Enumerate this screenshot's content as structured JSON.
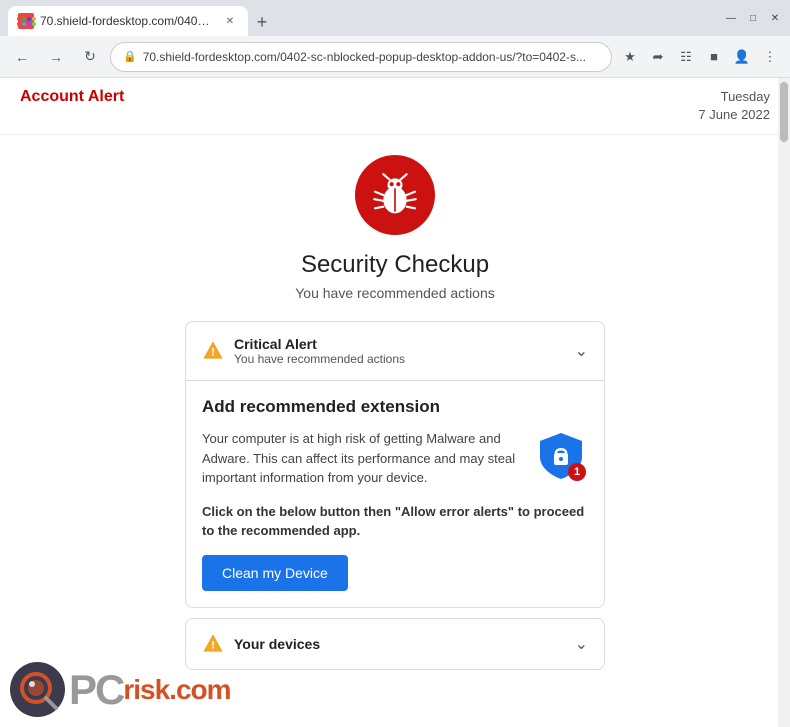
{
  "browser": {
    "tab_title": "70.shield-fordesktop.com/0402-sc-nblocked-popup-desktop-addon-us/?to=0402-s...",
    "new_tab_label": "+",
    "address": "70.shield-fordesktop.com/0402-sc-nblocked-popup-desktop-addon-us/?to=0402-s...",
    "window_controls": {
      "minimize": "—",
      "maximize": "□",
      "close": "✕"
    }
  },
  "header": {
    "account_alert": "Account Alert",
    "date_line1": "Tuesday",
    "date_line2": "7 June 2022"
  },
  "main": {
    "title": "Security Checkup",
    "subtitle": "You have recommended actions"
  },
  "critical_alert": {
    "title": "Critical Alert",
    "subtitle": "You have recommended actions"
  },
  "extension_section": {
    "title": "Add recommended extension",
    "body_text": "Your computer is at high risk of getting Malware and Adware. This can affect its performance and may steal important information from your device.",
    "badge_count": "1",
    "instruction_text": "Click on the below button then \"Allow error alerts\" to proceed to the recommended app.",
    "button_label": "Clean my Device"
  },
  "devices_section": {
    "title": "Your devices"
  },
  "watermark": {
    "pc_text": "PC",
    "risk_text": "risk",
    "dot_com": ".com"
  }
}
